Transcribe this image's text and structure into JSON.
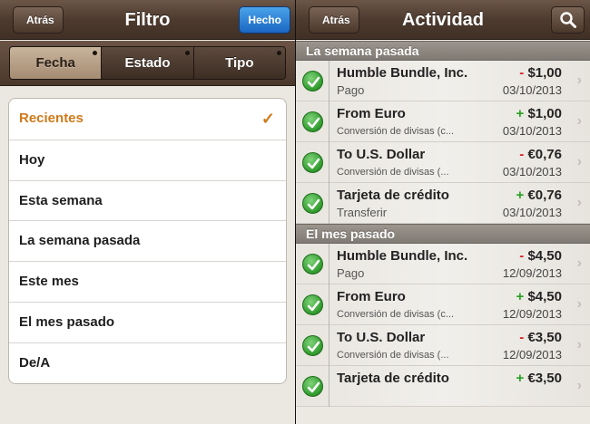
{
  "left_panel": {
    "back_label": "Atrás",
    "title": "Filtro",
    "done_label": "Hecho",
    "segments": [
      {
        "label": "Fecha",
        "active": true
      },
      {
        "label": "Estado",
        "active": false
      },
      {
        "label": "Tipo",
        "active": false
      }
    ],
    "filters": [
      {
        "label": "Recientes",
        "selected": true
      },
      {
        "label": "Hoy",
        "selected": false
      },
      {
        "label": "Esta semana",
        "selected": false
      },
      {
        "label": "La semana pasada",
        "selected": false
      },
      {
        "label": "Este mes",
        "selected": false
      },
      {
        "label": "El mes pasado",
        "selected": false
      },
      {
        "label": "De/A",
        "selected": false
      }
    ],
    "check_glyph": "✓"
  },
  "right_panel": {
    "back_label": "Atrás",
    "title": "Actividad",
    "search_icon": "search-icon",
    "sections": [
      {
        "header": "La semana pasada",
        "rows": [
          {
            "name": "Humble Bundle, Inc.",
            "sub": "Pago",
            "sign": "-",
            "amount": "$1,00",
            "date": "03/10/2013"
          },
          {
            "name": "From Euro",
            "sub": "Conversión de divisas (c...",
            "sign": "+",
            "amount": "$1,00",
            "date": "03/10/2013"
          },
          {
            "name": "To U.S. Dollar",
            "sub": "Conversión de divisas (...",
            "sign": "-",
            "amount": "€0,76",
            "date": "03/10/2013"
          },
          {
            "name": "Tarjeta de crédito",
            "sub": "Transferir",
            "sign": "+",
            "amount": "€0,76",
            "date": "03/10/2013"
          }
        ]
      },
      {
        "header": "El mes pasado",
        "rows": [
          {
            "name": "Humble Bundle, Inc.",
            "sub": "Pago",
            "sign": "-",
            "amount": "$4,50",
            "date": "12/09/2013"
          },
          {
            "name": "From Euro",
            "sub": "Conversión de divisas (c...",
            "sign": "+",
            "amount": "$4,50",
            "date": "12/09/2013"
          },
          {
            "name": "To U.S. Dollar",
            "sub": "Conversión de divisas (...",
            "sign": "-",
            "amount": "€3,50",
            "date": "12/09/2013"
          },
          {
            "name": "Tarjeta de crédito",
            "sub": "",
            "sign": "+",
            "amount": "€3,50",
            "date": ""
          }
        ]
      }
    ]
  },
  "colors": {
    "accent_orange": "#d07a1a",
    "done_blue": "#1a66c2",
    "negative_red": "#d42020",
    "positive_green": "#27a022"
  }
}
